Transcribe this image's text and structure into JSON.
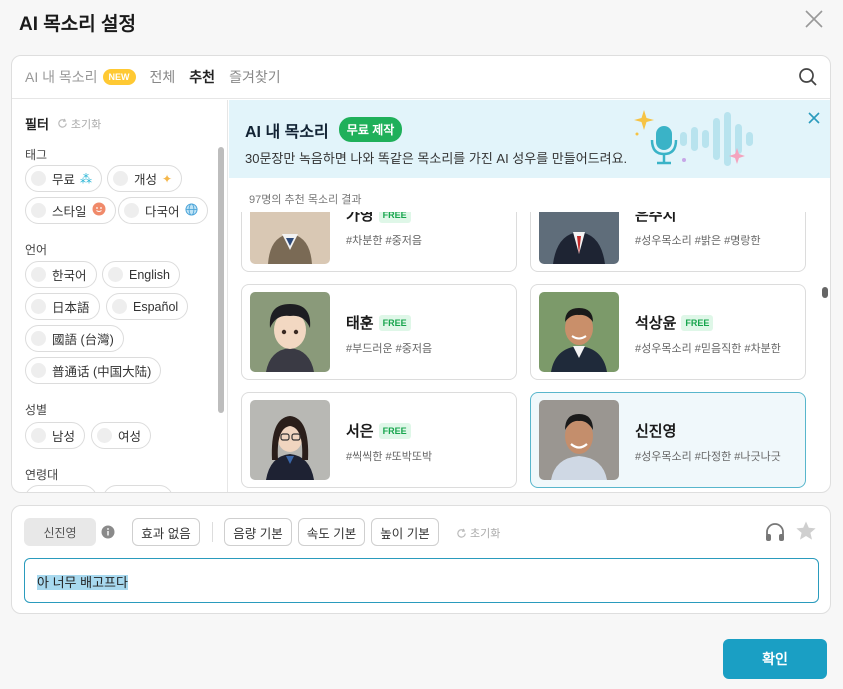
{
  "dialog": {
    "title": "AI 목소리 설정"
  },
  "tabs": {
    "my_voice": "AI 내 목소리",
    "new_badge": "NEW",
    "all": "전체",
    "recommended": "추천",
    "favorites": "즐겨찾기"
  },
  "filter": {
    "title": "필터",
    "reset": "초기화",
    "tag_label": "태그",
    "tags": [
      {
        "label": "무료"
      },
      {
        "label": "개성"
      },
      {
        "label": "스타일"
      },
      {
        "label": "다국어"
      }
    ],
    "language_label": "언어",
    "languages": [
      {
        "label": "한국어"
      },
      {
        "label": "English"
      },
      {
        "label": "日本語"
      },
      {
        "label": "Español"
      },
      {
        "label": "國語 (台灣)"
      },
      {
        "label": "普通话 (中国大陆)"
      }
    ],
    "gender_label": "성별",
    "genders": [
      {
        "label": "남성"
      },
      {
        "label": "여성"
      }
    ],
    "age_label": "연령대"
  },
  "banner": {
    "title": "AI 내 목소리",
    "badge": "무료 제작",
    "description": "30문장만 녹음하면 나와 똑같은 목소리를 가진 AI 성우를 만들어드려요."
  },
  "results": {
    "count_text": "97명의 추천 목소리 결과"
  },
  "voices": [
    {
      "name": "가영",
      "free_label": "FREE",
      "tags": "#차분한 #중저음"
    },
    {
      "name": "은수지",
      "free_label": "",
      "tags": "#성우목소리 #밝은 #명랑한"
    },
    {
      "name": "태훈",
      "free_label": "FREE",
      "tags": "#부드러운 #중저음"
    },
    {
      "name": "석상윤",
      "free_label": "FREE",
      "tags": "#성우목소리 #믿음직한 #차분한"
    },
    {
      "name": "서은",
      "free_label": "FREE",
      "tags": "#씩씩한 #또박또박"
    },
    {
      "name": "신진영",
      "free_label": "",
      "tags": "#성우목소리 #다정한 #나긋나긋"
    }
  ],
  "controls": {
    "selected_voice": "신진영",
    "effect": "효과 없음",
    "volume": "음량 기본",
    "speed": "속도 기본",
    "pitch": "높이 기본",
    "reset": "초기화"
  },
  "input": {
    "value": "아 너무 배고프다"
  },
  "footer": {
    "confirm": "확인"
  },
  "colors": {
    "accent": "#1a9fc4",
    "free_green": "#1fb05a",
    "new_badge": "#ffc933",
    "banner_bg": "#e2f4fa"
  }
}
